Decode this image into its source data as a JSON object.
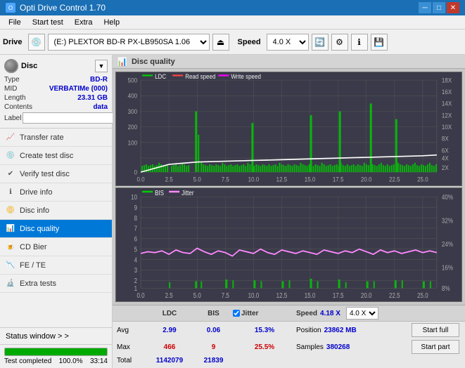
{
  "titleBar": {
    "title": "Opti Drive Control 1.70",
    "minBtn": "─",
    "maxBtn": "□",
    "closeBtn": "✕"
  },
  "menuBar": {
    "items": [
      "File",
      "Start test",
      "Extra",
      "Help"
    ]
  },
  "toolbar": {
    "driveLabel": "Drive",
    "driveValue": "(E:)  PLEXTOR BD-R  PX-LB950SA 1.06",
    "speedLabel": "Speed",
    "speedValue": "4.0 X"
  },
  "disc": {
    "typeLabel": "Type",
    "typeValue": "BD-R",
    "midLabel": "MID",
    "midValue": "VERBATIMe (000)",
    "lengthLabel": "Length",
    "lengthValue": "23.31 GB",
    "contentsLabel": "Contents",
    "contentsValue": "data",
    "labelLabel": "Label",
    "labelValue": ""
  },
  "nav": {
    "items": [
      {
        "id": "transfer-rate",
        "label": "Transfer rate",
        "icon": "📈"
      },
      {
        "id": "create-test-disc",
        "label": "Create test disc",
        "icon": "💿"
      },
      {
        "id": "verify-test-disc",
        "label": "Verify test disc",
        "icon": "✔"
      },
      {
        "id": "drive-info",
        "label": "Drive info",
        "icon": "ℹ"
      },
      {
        "id": "disc-info",
        "label": "Disc info",
        "icon": "📀"
      },
      {
        "id": "disc-quality",
        "label": "Disc quality",
        "icon": "📊",
        "active": true
      },
      {
        "id": "cd-bier",
        "label": "CD Bier",
        "icon": "🍺"
      },
      {
        "id": "fe-te",
        "label": "FE / TE",
        "icon": "📉"
      },
      {
        "id": "extra-tests",
        "label": "Extra tests",
        "icon": "🔬"
      }
    ]
  },
  "statusWindow": {
    "label": "Status window > >"
  },
  "progress": {
    "percent": 100,
    "percentText": "100.0%",
    "timeText": "33:14",
    "statusText": "Test completed"
  },
  "panelTitle": "Disc quality",
  "chart1": {
    "legendItems": [
      {
        "label": "LDC",
        "color": "#00cc00"
      },
      {
        "label": "Read speed",
        "color": "#ff4444"
      },
      {
        "label": "Write speed",
        "color": "#ff00ff"
      }
    ],
    "xMax": 25,
    "yLeftMax": 500,
    "yRightMax": 18,
    "yLeftTicks": [
      0,
      100,
      200,
      300,
      400,
      500
    ],
    "yRightTicks": [
      2,
      4,
      6,
      8,
      10,
      12,
      14,
      16,
      18
    ],
    "xTicks": [
      0,
      2.5,
      5.0,
      7.5,
      10.0,
      12.5,
      15.0,
      17.5,
      20.0,
      22.5,
      25.0
    ]
  },
  "chart2": {
    "legendItems": [
      {
        "label": "BIS",
        "color": "#00cc00"
      },
      {
        "label": "Jitter",
        "color": "#ff00ff"
      }
    ],
    "xMax": 25,
    "yLeftMax": 10,
    "yRightMax": 40,
    "yLeftTicks": [
      1,
      2,
      3,
      4,
      5,
      6,
      7,
      8,
      9,
      10
    ],
    "yRightTicks": [
      8,
      16,
      24,
      32,
      40
    ],
    "xTicks": [
      0,
      2.5,
      5.0,
      7.5,
      10.0,
      12.5,
      15.0,
      17.5,
      20.0,
      22.5,
      25.0
    ]
  },
  "stats": {
    "headers": {
      "ldc": "LDC",
      "bis": "BIS",
      "jitter": "Jitter",
      "speed": "Speed",
      "speedVal": "4.18 X"
    },
    "jitterCheckbox": true,
    "rows": [
      {
        "label": "Avg",
        "ldc": "2.99",
        "bis": "0.06",
        "jitter": "15.3%",
        "posLabel": "Position",
        "posVal": "23862 MB"
      },
      {
        "label": "Max",
        "ldc": "466",
        "bis": "9",
        "jitter": "25.5%",
        "sampLabel": "Samples",
        "sampVal": "380268"
      },
      {
        "label": "Total",
        "ldc": "1142079",
        "bis": "21839",
        "jitter": ""
      }
    ],
    "buttons": {
      "startFull": "Start full",
      "startPart": "Start part"
    },
    "speedDropdown": "4.0 X"
  }
}
